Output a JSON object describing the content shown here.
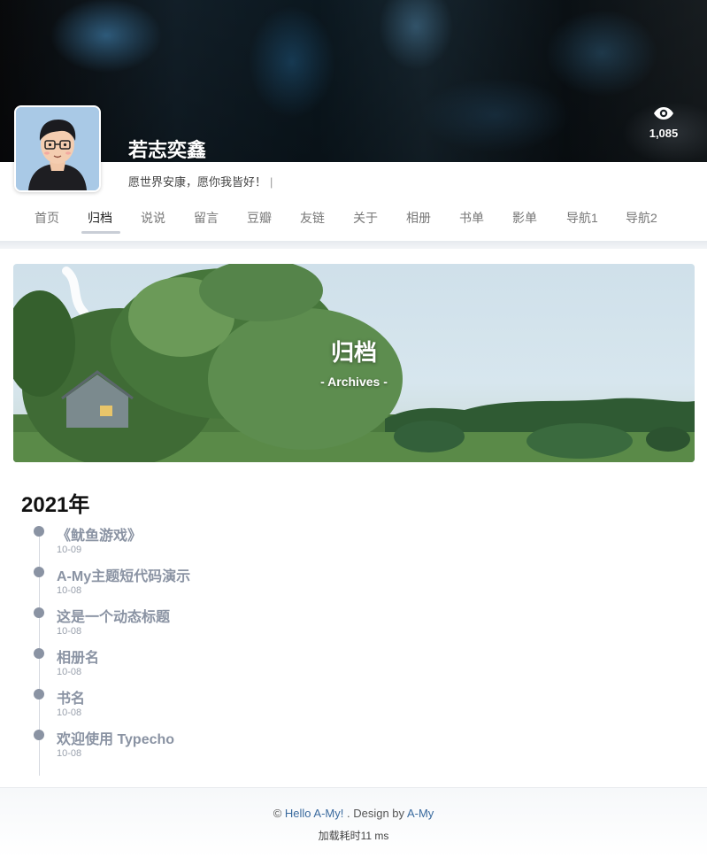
{
  "header": {
    "site_name": "若志奕鑫",
    "motto": "愿世界安康，愿你我皆好！",
    "motto_caret": "|",
    "view_count": "1,085",
    "view_icon": "eye-icon"
  },
  "nav": {
    "items": [
      {
        "label": "首页"
      },
      {
        "label": "归档"
      },
      {
        "label": "说说"
      },
      {
        "label": "留言"
      },
      {
        "label": "豆瓣"
      },
      {
        "label": "友链"
      },
      {
        "label": "关于"
      },
      {
        "label": "相册"
      },
      {
        "label": "书单"
      },
      {
        "label": "影单"
      },
      {
        "label": "导航1"
      },
      {
        "label": "导航2"
      }
    ],
    "active": "归档"
  },
  "banner": {
    "title": "归档",
    "subtitle": "- Archives -"
  },
  "archive": {
    "year": "2021年",
    "entries": [
      {
        "title": "《鱿鱼游戏》",
        "date": "10-09"
      },
      {
        "title": "A-My主题短代码演示",
        "date": "10-08"
      },
      {
        "title": "这是一个动态标题",
        "date": "10-08"
      },
      {
        "title": "相册名",
        "date": "10-08"
      },
      {
        "title": "书名",
        "date": "10-08"
      },
      {
        "title": "欢迎使用 Typecho",
        "date": "10-08"
      }
    ]
  },
  "footer": {
    "copyright": "©",
    "site_link": "Hello A-My!",
    "design_text": ". Design by",
    "theme_link": "A-My",
    "load_time": "加载耗时11 ms"
  },
  "colors": {
    "accent_link": "#3a6a9e",
    "entry_text": "#8a93a3",
    "timeline_dot": "#8a93a3"
  }
}
